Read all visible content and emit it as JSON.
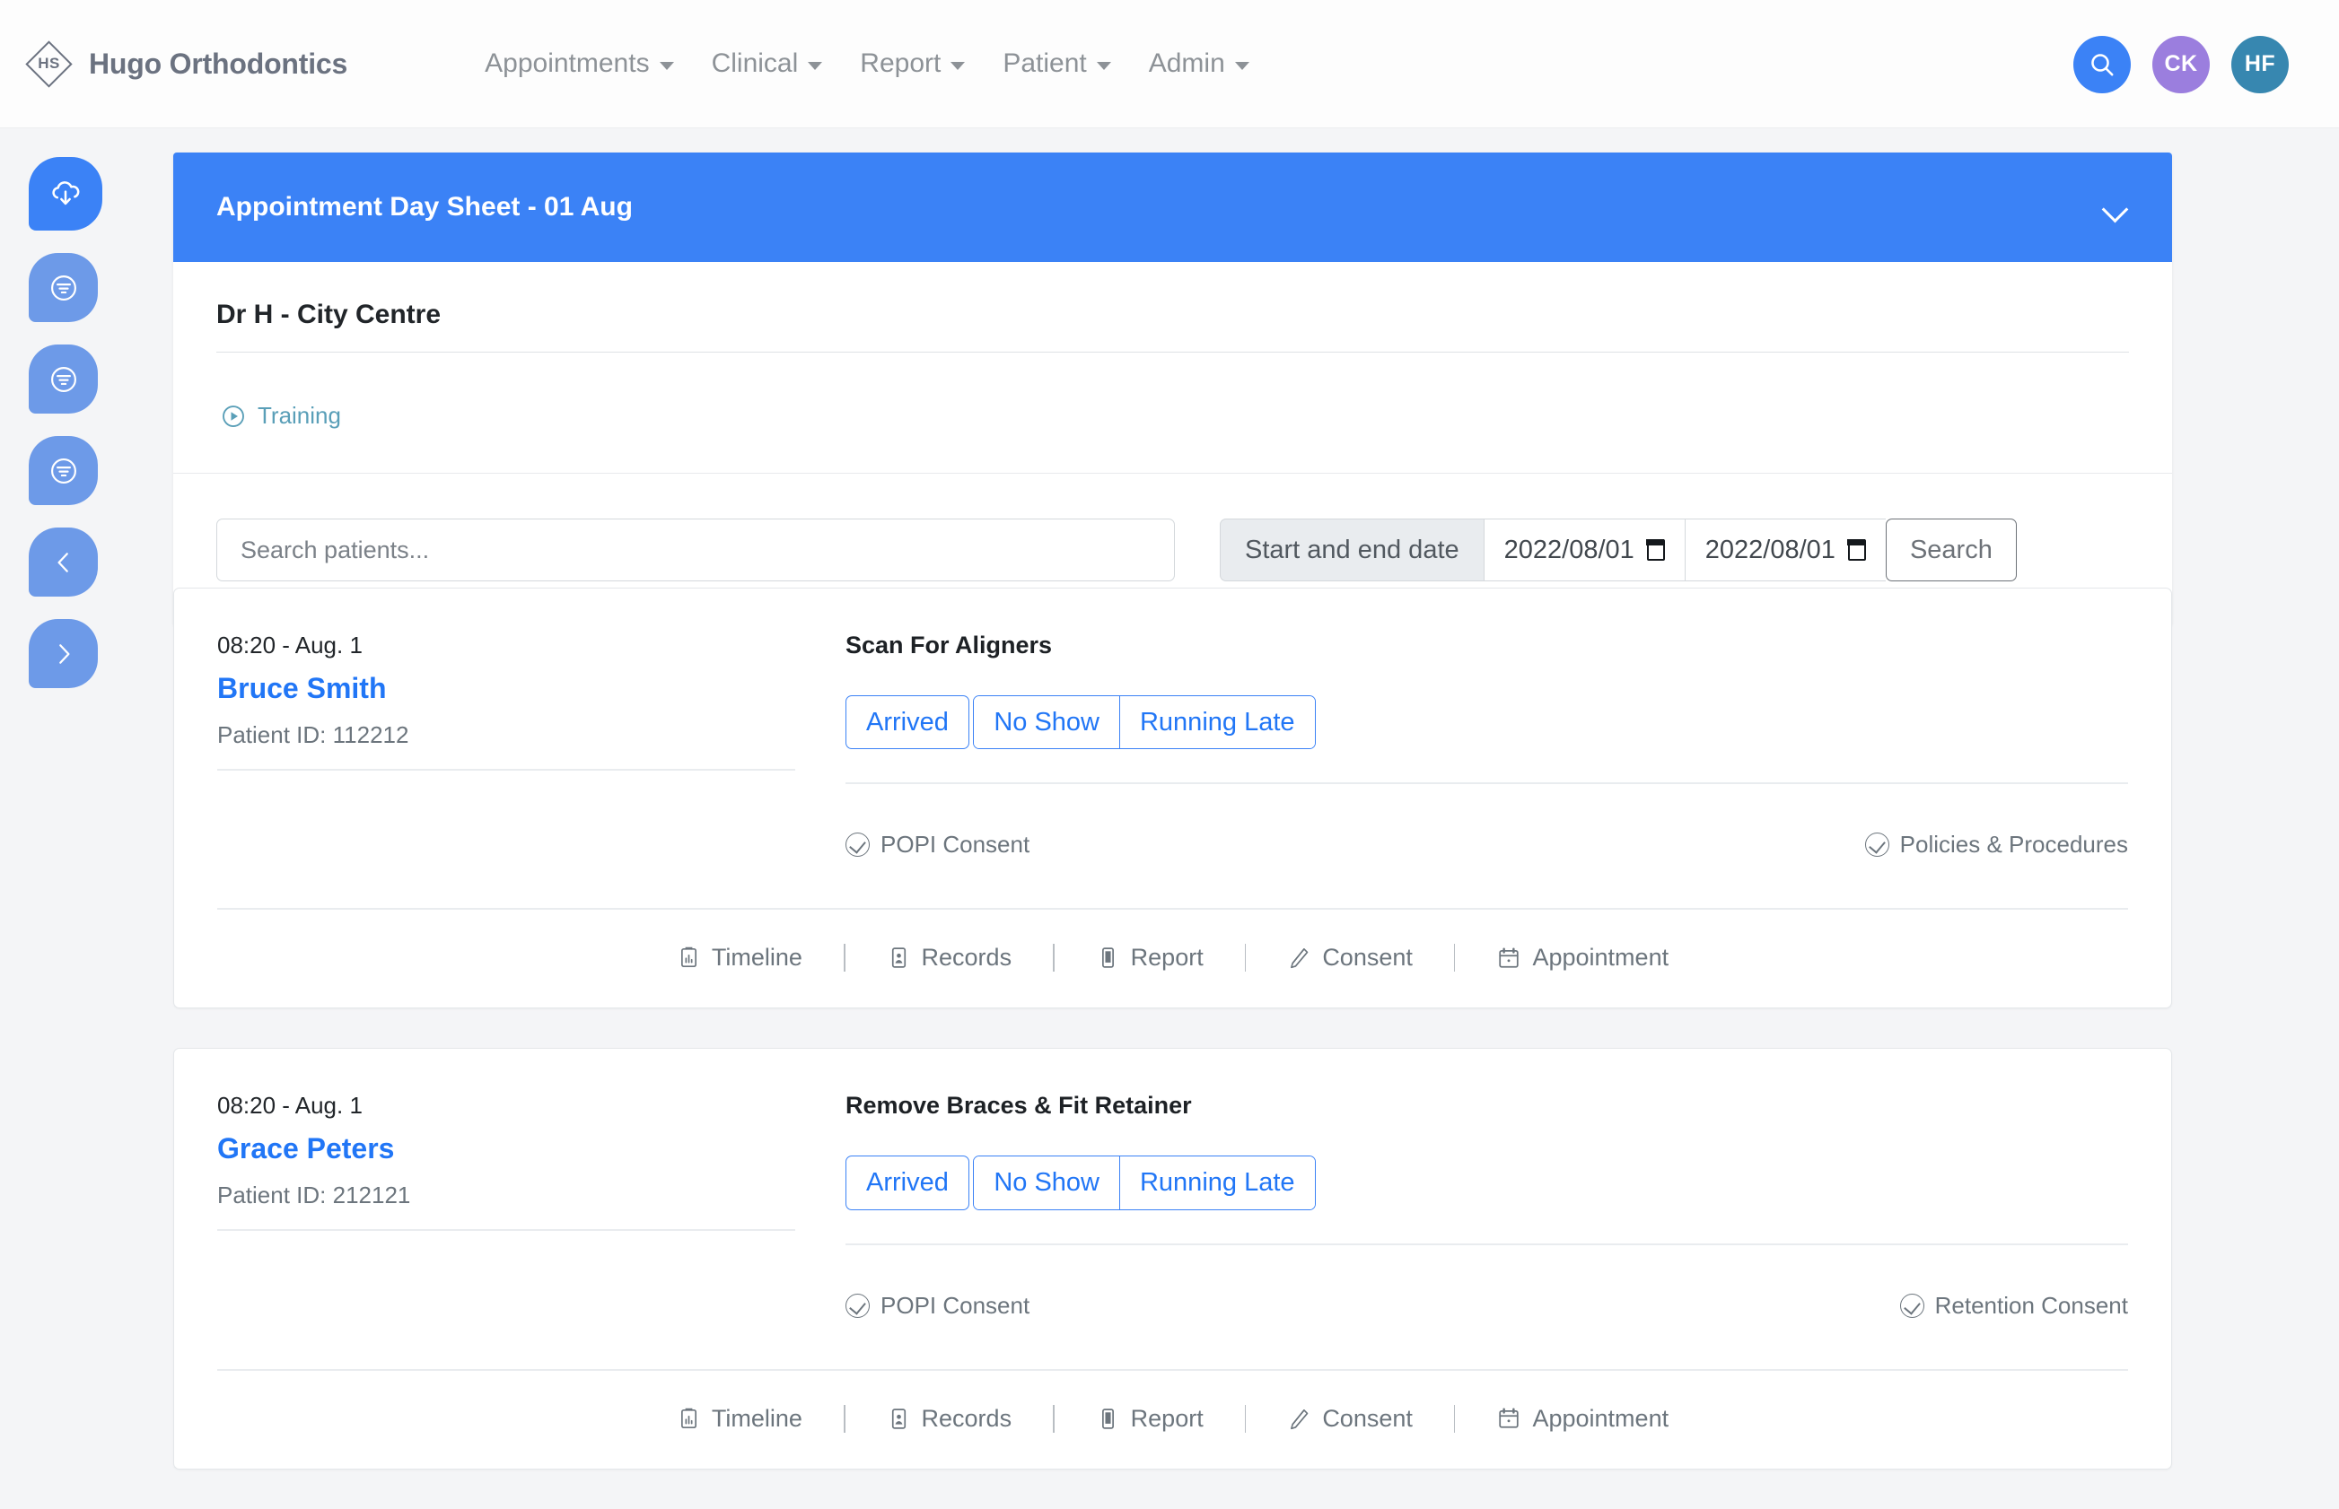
{
  "brand": {
    "logo_text": "HS",
    "name": "Hugo Orthodontics",
    "logo_icon": "diamond-hs-logo"
  },
  "nav": {
    "items": [
      {
        "label": "Appointments",
        "has_caret": true
      },
      {
        "label": "Clinical",
        "has_caret": true
      },
      {
        "label": "Report",
        "has_caret": true
      },
      {
        "label": "Patient",
        "has_caret": true
      },
      {
        "label": "Admin",
        "has_caret": true
      }
    ],
    "right": {
      "search_icon": "search-icon",
      "avatars": [
        {
          "initials": "CK",
          "color": "#9b7ede"
        },
        {
          "initials": "HF",
          "color": "#3787b0"
        }
      ]
    }
  },
  "sidebar": {
    "items": [
      {
        "icon": "cloud-download-icon",
        "active": true
      },
      {
        "icon": "filter-circle-icon",
        "active": false
      },
      {
        "icon": "filter-circle-icon",
        "active": false
      },
      {
        "icon": "filter-circle-icon",
        "active": false
      },
      {
        "icon": "chevron-left-icon",
        "active": false
      },
      {
        "icon": "chevron-right-icon",
        "active": false
      }
    ]
  },
  "panel": {
    "header_title": "Appointment Day Sheet - 01 Aug",
    "header_color": "#3b82f6",
    "collapse_icon": "chevron-down-icon",
    "clinic_name": "Dr H - City Centre",
    "training_label": "Training",
    "training_icon": "play-circle-icon",
    "training_color": "#5a9fb8"
  },
  "search": {
    "placeholder": "Search patients...",
    "value": "",
    "date_label": "Start and end date",
    "start_date": "2022/08/01",
    "end_date": "2022/08/01",
    "calendar_icon": "calendar-icon",
    "search_button": "Search"
  },
  "buttons": {
    "arrived": "Arrived",
    "no_show": "No Show",
    "running_late": "Running Late",
    "accent": "#2176f6"
  },
  "actions": [
    {
      "label": "Timeline",
      "icon": "clipboard-chart-icon"
    },
    {
      "label": "Records",
      "icon": "person-document-icon"
    },
    {
      "label": "Report",
      "icon": "report-document-icon"
    },
    {
      "label": "Consent",
      "icon": "pencil-icon"
    },
    {
      "label": "Appointment",
      "icon": "calendar-icon"
    }
  ],
  "appointments": [
    {
      "time": "08:20 - Aug. 1",
      "patient_name": "Bruce Smith",
      "patient_id_label": "Patient ID: 112212",
      "appointment_type": "Scan For Aligners",
      "consents": [
        {
          "label": "POPI Consent",
          "icon": "check-circle-icon"
        },
        {
          "label": "Policies & Procedures",
          "icon": "check-circle-icon"
        }
      ]
    },
    {
      "time": "08:20 - Aug. 1",
      "patient_name": "Grace Peters",
      "patient_id_label": "Patient ID: 212121",
      "appointment_type": "Remove Braces & Fit Retainer",
      "consents": [
        {
          "label": "POPI Consent",
          "icon": "check-circle-icon"
        },
        {
          "label": "Retention Consent",
          "icon": "check-circle-icon"
        }
      ]
    }
  ]
}
